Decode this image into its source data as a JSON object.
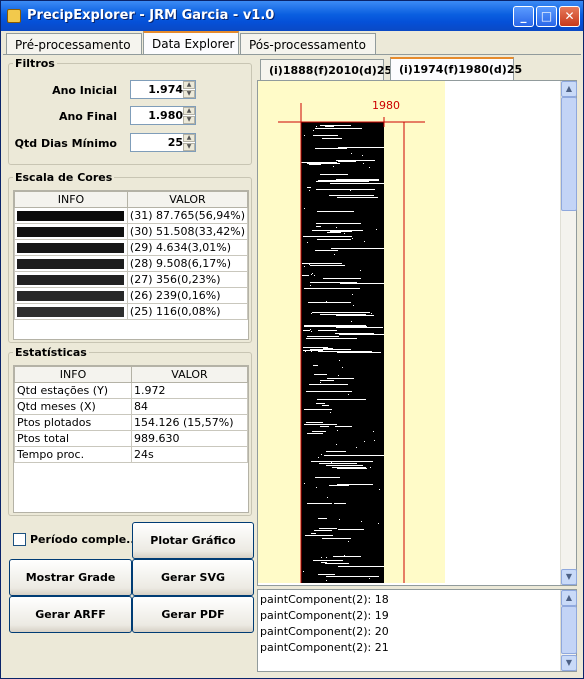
{
  "window": {
    "title": "PrecipExplorer - JRM Garcia - v1.0",
    "controls": {
      "minimize": "_",
      "maximize": "□",
      "close": "✕"
    }
  },
  "main_tabs": [
    "Pré-processamento",
    "Data Explorer",
    "Pós-processamento"
  ],
  "filters": {
    "legend": "Filtros",
    "ano_inicial": {
      "label": "Ano Inicial",
      "value": "1.974"
    },
    "ano_final": {
      "label": "Ano Final",
      "value": "1.980"
    },
    "qtd_dias": {
      "label": "Qtd Dias Mínimo",
      "value": "25"
    }
  },
  "color_scale": {
    "legend": "Escala de Cores",
    "headers": [
      "INFO",
      "VALOR"
    ],
    "rows": [
      {
        "color": "#0b0b0b",
        "value": "(31) 87.765(56,94%)"
      },
      {
        "color": "#111111",
        "value": "(30) 51.508(33,42%)"
      },
      {
        "color": "#171717",
        "value": "(29) 4.634(3,01%)"
      },
      {
        "color": "#1c1c1c",
        "value": "(28) 9.508(6,17%)"
      },
      {
        "color": "#222222",
        "value": "(27) 356(0,23%)"
      },
      {
        "color": "#282828",
        "value": "(26) 239(0,16%)"
      },
      {
        "color": "#2e2e2e",
        "value": "(25) 116(0,08%)"
      }
    ]
  },
  "statistics": {
    "legend": "Estatísticas",
    "headers": [
      "INFO",
      "VALOR"
    ],
    "rows": [
      {
        "info": "Qtd estações (Y)",
        "value": "1.972"
      },
      {
        "info": "Qtd meses (X)",
        "value": "84"
      },
      {
        "info": "Ptos plotados",
        "value": "154.126 (15,57%)"
      },
      {
        "info": "Ptos total",
        "value": "989.630"
      },
      {
        "info": "Tempo proc.",
        "value": "24s"
      }
    ]
  },
  "buttons": {
    "periodo": "Período comple...",
    "plotar": "Plotar Gráfico",
    "mostrar_grade": "Mostrar Grade",
    "gerar_svg": "Gerar SVG",
    "gerar_arff": "Gerar ARFF",
    "gerar_pdf": "Gerar PDF"
  },
  "chart_tabs": [
    "(i)1888(f)2010(d)25",
    "(i)1974(f)1980(d)25"
  ],
  "chart": {
    "year_label": "1980",
    "accent": "#cc0000",
    "background": "#fffbc8"
  },
  "log_lines": [
    "paintComponent(2): 18",
    "paintComponent(2): 19",
    "paintComponent(2): 20",
    "paintComponent(2): 21"
  ],
  "scroll_arrows": {
    "up": "▲",
    "down": "▼"
  }
}
